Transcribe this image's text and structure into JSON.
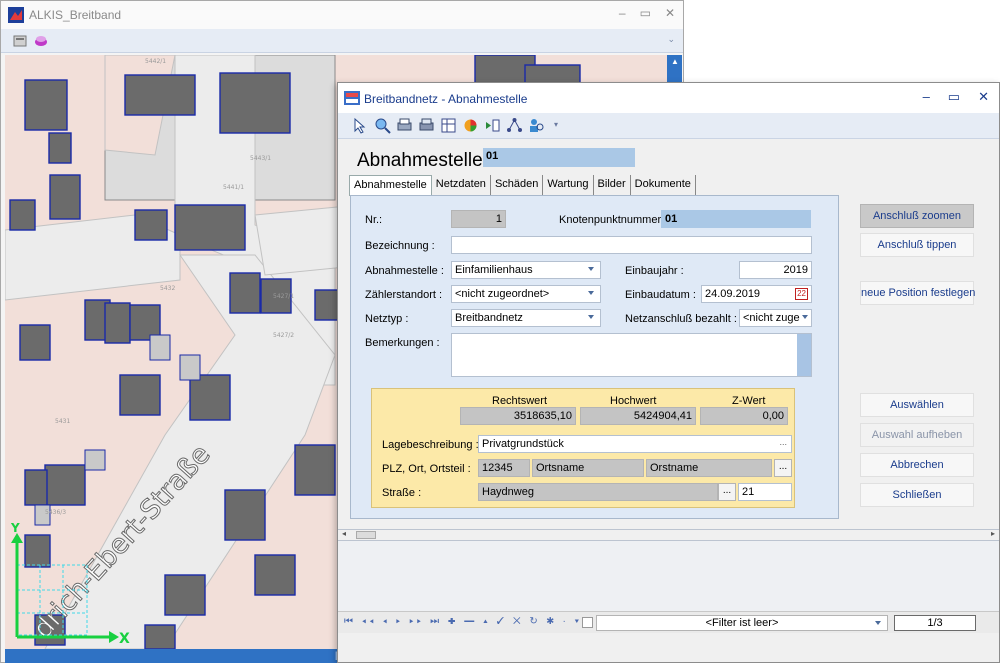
{
  "map_window": {
    "title": "ALKIS_Breitband",
    "street_label": "drich-Ebert-Straße",
    "axis_x": "X",
    "axis_y": "Y",
    "parcel_numbers": [
      "5442/1",
      "5443/1",
      "5441/1",
      "5427/1",
      "5427/2",
      "5431",
      "5432",
      "5436/3"
    ]
  },
  "dialog": {
    "title": "Breitbandnetz - Abnahmestelle",
    "form_title": "Abnahmestelle",
    "form_id": "01",
    "tabs": [
      "Abnahmestelle",
      "Netzdaten",
      "Schäden",
      "Wartung",
      "Bilder",
      "Dokumente"
    ],
    "fields": {
      "nr_label": "Nr.:",
      "nr_value": "1",
      "knoten_label": "Knotenpunktnummer :",
      "knoten_value": "01",
      "bezeichnung_label": "Bezeichnung :",
      "bezeichnung_value": "",
      "abnahmestelle_label": "Abnahmestelle :",
      "abnahmestelle_value": "Einfamilienhaus",
      "einbaujahr_label": "Einbaujahr :",
      "einbaujahr_value": "2019",
      "zaehler_label": "Zählerstandort :",
      "zaehler_value": "<nicht zugeordnet>",
      "einbaudatum_label": "Einbaudatum :",
      "einbaudatum_value": "24.09.2019",
      "calendar_day": "22",
      "netztyp_label": "Netztyp :",
      "netztyp_value": "Breitbandnetz",
      "netzanschluss_label": "Netzanschluß bezahlt :",
      "netzanschluss_value": "<nicht zuge",
      "bemerkungen_label": "Bemerkungen :",
      "bemerkungen_value": ""
    },
    "coords": {
      "rechtswert_label": "Rechtswert",
      "rechtswert_value": "3518635,10",
      "hochwert_label": "Hochwert",
      "hochwert_value": "5424904,41",
      "zwert_label": "Z-Wert",
      "zwert_value": "0,00",
      "lage_label": "Lagebeschreibung :",
      "lage_value": "Privatgrundstück",
      "plz_label": "PLZ, Ort, Ortsteil :",
      "plz_value": "12345",
      "ort_value": "Ortsname",
      "ortsteil_value": "Orstname",
      "strasse_label": "Straße :",
      "strasse_value": "Haydnweg",
      "hausnr_value": "21",
      "ellipsis": "..."
    },
    "side_buttons": {
      "zoom": "Anschluß zoomen",
      "tippen": "Anschluß tippen",
      "position": "neue Position festlegen",
      "auswaehlen": "Auswählen",
      "aufheben": "Auswahl aufheben",
      "abbrechen": "Abbrechen",
      "schliessen": "Schließen"
    },
    "nav": {
      "filter": "<Filter ist leer>",
      "record": "1/3"
    }
  },
  "colors": {
    "map_bg": "#f2dfd9",
    "building_fill": "#6b6b6b",
    "building_stroke": "#1a2aa8",
    "street": "#e9e9e9",
    "accent": "#2f72c4",
    "coord_box": "#fce9a8"
  }
}
